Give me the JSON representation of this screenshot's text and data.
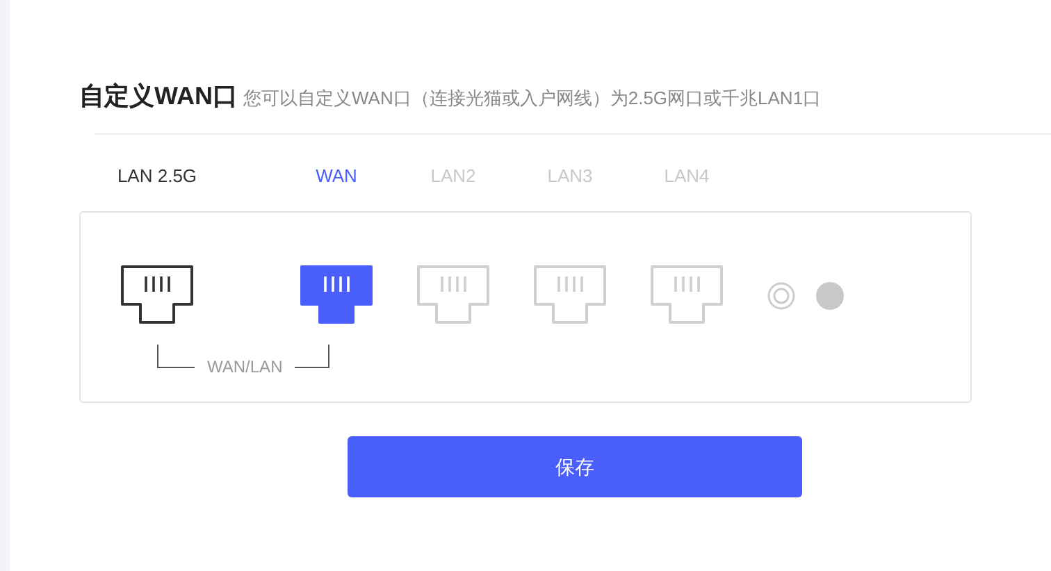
{
  "title": "自定义WAN口",
  "subtitle": "您可以自定义WAN口（连接光猫或入户网线）为2.5G网口或千兆LAN1口",
  "ports": [
    {
      "label": "LAN 2.5G",
      "kind": "normal"
    },
    {
      "label": "WAN",
      "kind": "wan"
    },
    {
      "label": "LAN2",
      "kind": "disabled"
    },
    {
      "label": "LAN3",
      "kind": "disabled"
    },
    {
      "label": "LAN4",
      "kind": "disabled"
    }
  ],
  "bracket_label": "WAN/LAN",
  "save_button": "保存"
}
